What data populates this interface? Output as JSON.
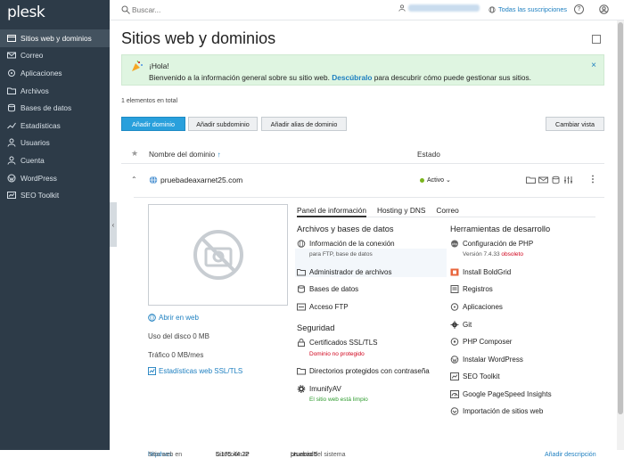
{
  "brand": {
    "logo": "plesk"
  },
  "sidebar": {
    "items": [
      {
        "label": "Sitios web y dominios",
        "icon": "web-icon",
        "active": true
      },
      {
        "label": "Correo",
        "icon": "mail-icon"
      },
      {
        "label": "Aplicaciones",
        "icon": "apps-icon"
      },
      {
        "label": "Archivos",
        "icon": "folder-icon"
      },
      {
        "label": "Bases de datos",
        "icon": "database-icon"
      },
      {
        "label": "Estadísticas",
        "icon": "chart-icon"
      },
      {
        "label": "Usuarios",
        "icon": "user-icon"
      },
      {
        "label": "Cuenta",
        "icon": "account-icon"
      },
      {
        "label": "WordPress",
        "icon": "wordpress-icon"
      },
      {
        "label": "SEO Toolkit",
        "icon": "seo-icon"
      }
    ]
  },
  "topbar": {
    "search_placeholder": "Buscar...",
    "subscriptions": "Todas las suscripciones",
    "help": "?"
  },
  "page": {
    "title": "Sitios web y dominios",
    "banner": {
      "heading": "¡Hola!",
      "text_before": "Bienvenido a la información general sobre su sitio web.",
      "link": "Descúbralo",
      "text_after": "para descubrir cómo puede gestionar sus sitios.",
      "close": "×"
    },
    "count": "1 elementos en total",
    "buttons": {
      "add_domain": "Añadir dominio",
      "add_subdomain": "Añadir subdominio",
      "add_alias": "Añadir alias de dominio",
      "change_view": "Cambiar vista"
    },
    "table": {
      "col_name": "Nombre del dominio",
      "col_name_sort": "↑",
      "col_status": "Estado"
    },
    "domain": {
      "name": "pruebadeaxarnet25.com",
      "status": "Activo",
      "status_color": "#7ab51d"
    },
    "left": {
      "open_web": "Abrir en web",
      "disk": "Uso del disco 0 MB",
      "traffic": "Tráfico 0 MB/mes",
      "stats": "Estadísticas web SSL/TLS"
    },
    "tabs": [
      "Panel de información",
      "Hosting y DNS",
      "Correo"
    ],
    "files_section": {
      "title": "Archivos y bases de datos",
      "items": [
        {
          "label": "Información de la conexión",
          "sub": "para FTP, base de datos"
        },
        {
          "label": "Administrador de archivos"
        },
        {
          "label": "Bases de datos"
        },
        {
          "label": "Acceso FTP"
        }
      ]
    },
    "security_section": {
      "title": "Seguridad",
      "items": [
        {
          "label": "Certificados SSL/TLS",
          "sub": "Dominio no protegido"
        },
        {
          "label": "Directorios protegidos con contraseña"
        },
        {
          "label": "ImunifyAV",
          "sub": "El sitio web está limpio"
        }
      ]
    },
    "dev_section": {
      "title": "Herramientas de desarrollo",
      "items": [
        {
          "label": "Configuración de PHP",
          "sub_version": "Versión 7.4.33",
          "sub_flag": "obsoleto"
        },
        {
          "label": "Install BoldGrid"
        },
        {
          "label": "Registros"
        },
        {
          "label": "Aplicaciones"
        },
        {
          "label": "Git"
        },
        {
          "label": "PHP Composer"
        },
        {
          "label": "Instalar WordPress"
        },
        {
          "label": "SEO Toolkit"
        },
        {
          "label": "Google PageSpeed Insights"
        },
        {
          "label": "Importación de sitios web"
        }
      ]
    },
    "footer": {
      "site_label": "Sitio web en",
      "site_link": "httpdocs",
      "ip_label": "Dirección IP",
      "ip": "5.175.44.22",
      "user_label": "Usuario del sistema",
      "user": "pruebad5",
      "add_desc": "Añadir descripción"
    }
  },
  "colors": {
    "accent": "#1d7fc0",
    "sidebar": "#2d3b48",
    "primary_button": "#29a0dc",
    "danger": "#d0021b",
    "ok": "#2e9b2e"
  }
}
